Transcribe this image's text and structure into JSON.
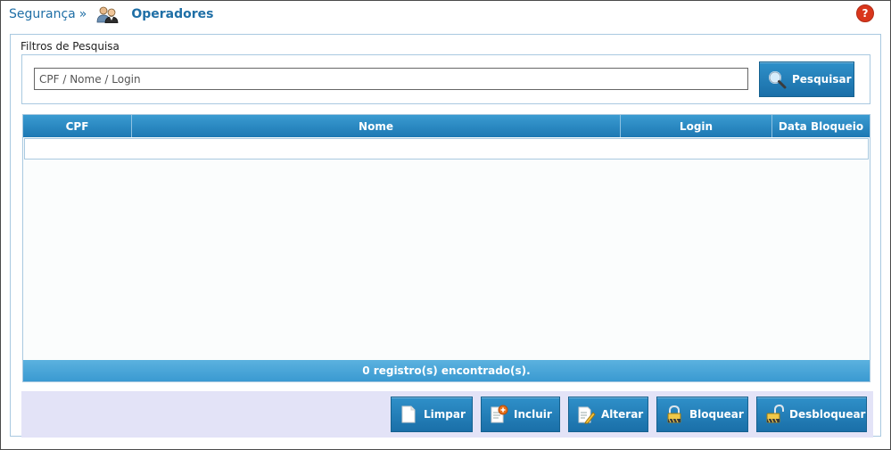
{
  "breadcrumb": {
    "parent": "Segurança",
    "separator": "»",
    "icon": "users-icon",
    "title": "Operadores"
  },
  "help": {
    "icon": "help-icon",
    "label": "?"
  },
  "filters": {
    "legend": "Filtros de Pesquisa",
    "search_placeholder": "CPF / Nome / Login",
    "search_value": "",
    "search_button": "Pesquisar",
    "search_icon": "magnifier-icon"
  },
  "grid": {
    "columns": [
      "CPF",
      "Nome",
      "Login",
      "Data Bloqueio"
    ],
    "rows": [],
    "footer": "0 registro(s) encontrado(s)."
  },
  "toolbar": {
    "limpar": "Limpar",
    "incluir": "Incluir",
    "alterar": "Alterar",
    "bloquear": "Bloquear",
    "desbloquear": "Desbloquear"
  },
  "colors": {
    "accent": "#1f6fa6",
    "button": "#1a6fa8",
    "help": "#d9361c",
    "toolbar_bg": "#e3e3f7"
  }
}
